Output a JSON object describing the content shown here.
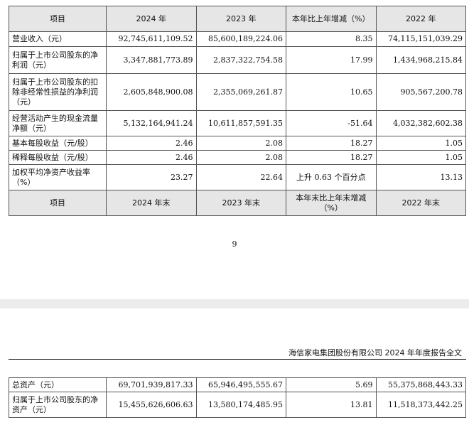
{
  "table1": {
    "header": [
      "项目",
      "2024 年",
      "2023 年",
      "本年比上年增减（%）",
      "2022 年"
    ],
    "rows": [
      [
        "营业收入（元）",
        "92,745,611,109.52",
        "85,600,189,224.06",
        "8.35",
        "74,115,151,039.29"
      ],
      [
        "归属于上市公司股东的净利润（元）",
        "3,347,881,773.89",
        "2,837,322,754.58",
        "17.99",
        "1,434,968,215.84"
      ],
      [
        "归属于上市公司股东的扣除非经常性损益的净利润（元）",
        "2,605,848,900.08",
        "2,355,069,261.87",
        "10.65",
        "905,567,200.78"
      ],
      [
        "经营活动产生的现金流量净额（元）",
        "5,132,164,941.24",
        "10,611,857,591.35",
        "-51.64",
        "4,032,382,602.38"
      ],
      [
        "基本每股收益（元/股）",
        "2.46",
        "2.08",
        "18.27",
        "1.05"
      ],
      [
        "稀释每股收益（元/股）",
        "2.46",
        "2.08",
        "18.27",
        "1.05"
      ],
      [
        "加权平均净资产收益率（%）",
        "23.27",
        "22.64",
        "上升 0.63 个百分点",
        "13.13"
      ]
    ],
    "header2": [
      "项目",
      "2024 年末",
      "2023 年末",
      "本年末比上年末增减（%）",
      "2022 年末"
    ]
  },
  "page_number": "9",
  "running_header": "海信家电集团股份有限公司 2024 年年度报告全文",
  "table2": {
    "rows": [
      [
        "总资产（元）",
        "69,701,939,817.33",
        "65,946,495,555.67",
        "5.69",
        "55,375,868,443.33"
      ],
      [
        "归属于上市公司股东的净资产（元）",
        "15,455,626,606.63",
        "13,580,174,485.95",
        "13.81",
        "11,518,373,442.25"
      ]
    ]
  }
}
